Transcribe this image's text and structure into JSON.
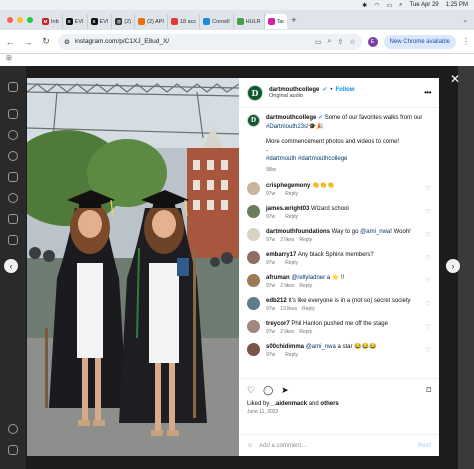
{
  "menubar": {
    "date": "Tue Apr 29",
    "time": "1:25 PM"
  },
  "tabs": [
    {
      "label": "Inb",
      "color": "#c5221f",
      "glyph": "M"
    },
    {
      "label": "EVI",
      "color": "#111111",
      "glyph": "X"
    },
    {
      "label": "EVI",
      "color": "#111111",
      "glyph": "X"
    },
    {
      "label": "(2)",
      "color": "#333333",
      "glyph": "@"
    },
    {
      "label": "(2) API",
      "color": "#e8710a",
      "glyph": ""
    },
    {
      "label": "18 acc",
      "color": "#e53935",
      "glyph": ""
    },
    {
      "label": "Cornell",
      "color": "#1e88e5",
      "glyph": ""
    },
    {
      "label": "HULR",
      "color": "#43a047",
      "glyph": ""
    },
    {
      "label": "Tar",
      "color": "#d6249f",
      "glyph": ""
    }
  ],
  "address": {
    "url": "instagram.com/p/C1XJ_E8ud_X/",
    "profile_initial": "E",
    "new_chrome_label": "New Chrome available"
  },
  "post": {
    "username": "dartmouthcollege",
    "follow_label": "Follow",
    "audio": "Original audio",
    "avatar_letter": "D",
    "caption_text": "Some of our favorites walks from our",
    "caption_tag": "#Dartmouth23s!🎓🎉",
    "caption_more": "More commencement photos and videos to come!",
    "caption_dash": "-",
    "caption_tags": "#dartmouth #dartmouthcollege",
    "caption_time": "98w"
  },
  "comments": [
    {
      "user": "crisphegemony",
      "text": "👏👏👏",
      "time": "97w",
      "likes": "",
      "reply": "Reply",
      "color": "#c8b59a"
    },
    {
      "user": "james.wright03",
      "text": "Wizard school",
      "time": "97w",
      "likes": "",
      "reply": "Reply",
      "color": "#6a7d5c"
    },
    {
      "user": "dartmouthfoundations",
      "text": "Way to go @ami_nwa! Wooh!",
      "time": "97w",
      "likes": "2 likes",
      "reply": "Reply",
      "color": "#d9d2c5"
    },
    {
      "user": "embarry17",
      "text": "Any black Sphinx members?",
      "time": "97w",
      "likes": "",
      "reply": "Reply",
      "color": "#8d6e63"
    },
    {
      "user": "afruman",
      "text": "@rellyladner a ⭐ !!",
      "time": "97w",
      "likes": "2 likes",
      "reply": "Reply",
      "color": "#9c7a54"
    },
    {
      "user": "edb212",
      "text": "It's like everyone is in a (not so) secret society",
      "time": "97w",
      "likes": "13 likes",
      "reply": "Reply",
      "color": "#5f7c8a"
    },
    {
      "user": "treycor7",
      "text": "Phil Hanlon pushed me off the stage",
      "time": "97w",
      "likes": "2 likes",
      "reply": "Reply",
      "color": "#a1887f"
    },
    {
      "user": "s00chidimma",
      "text": "@ami_nwa a star 😂😂😂",
      "time": "97w",
      "likes": "",
      "reply": "Reply",
      "color": "#795548"
    }
  ],
  "footer": {
    "liked_prefix": "Liked by",
    "liked_user": "_.aidenmack",
    "liked_and": "and",
    "liked_others": "others",
    "date": "June 11, 2023",
    "add_comment_placeholder": "Add a comment…",
    "post_label": "Post"
  }
}
